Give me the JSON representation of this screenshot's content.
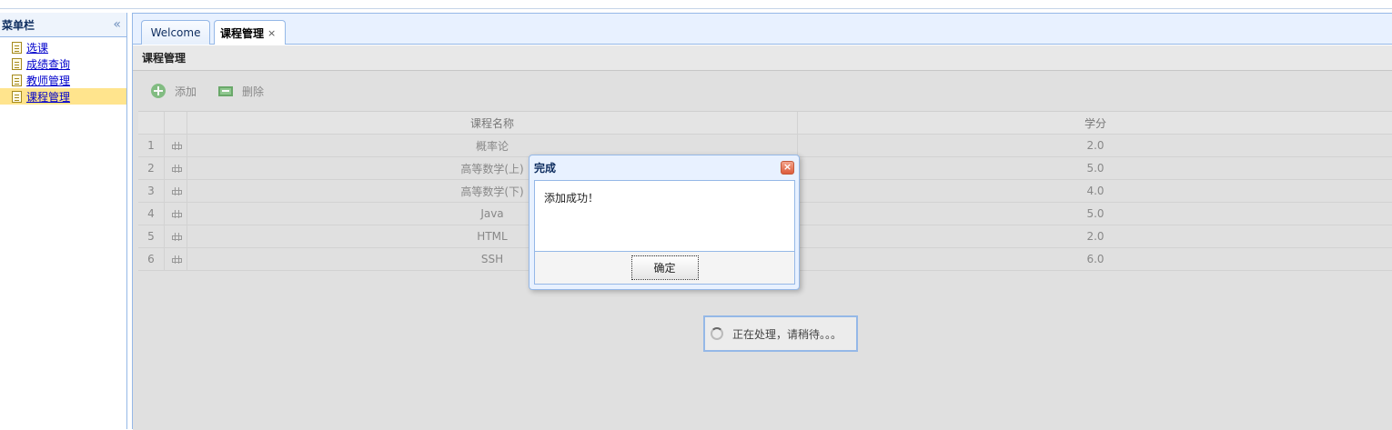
{
  "menu": {
    "title": "菜单栏",
    "collapse_icon": "«",
    "items": [
      {
        "label": "选课",
        "active": false
      },
      {
        "label": "成绩查询",
        "active": false
      },
      {
        "label": "教师管理",
        "active": false
      },
      {
        "label": "课程管理",
        "active": true
      }
    ]
  },
  "tabs": [
    {
      "label": "Welcome"
    },
    {
      "label": "课程管理",
      "close": "×"
    }
  ],
  "panel": {
    "title": "课程管理"
  },
  "toolbar": {
    "add_label": "添加",
    "delete_label": "删除"
  },
  "table": {
    "headers": [
      "课程名称",
      "学分"
    ],
    "rows": [
      {
        "num": "1",
        "name": "概率论",
        "credit": "2.0"
      },
      {
        "num": "2",
        "name": "高等数学(上)",
        "credit": "5.0"
      },
      {
        "num": "3",
        "name": "高等数学(下)",
        "credit": "4.0"
      },
      {
        "num": "4",
        "name": "Java",
        "credit": "5.0"
      },
      {
        "num": "5",
        "name": "HTML",
        "credit": "2.0"
      },
      {
        "num": "6",
        "name": "SSH",
        "credit": "6.0"
      }
    ]
  },
  "dialog": {
    "title": "完成",
    "message": "添加成功！",
    "ok_label": "确定",
    "close": "×"
  },
  "loading": {
    "message": "正在处理，请稍待。。。"
  }
}
